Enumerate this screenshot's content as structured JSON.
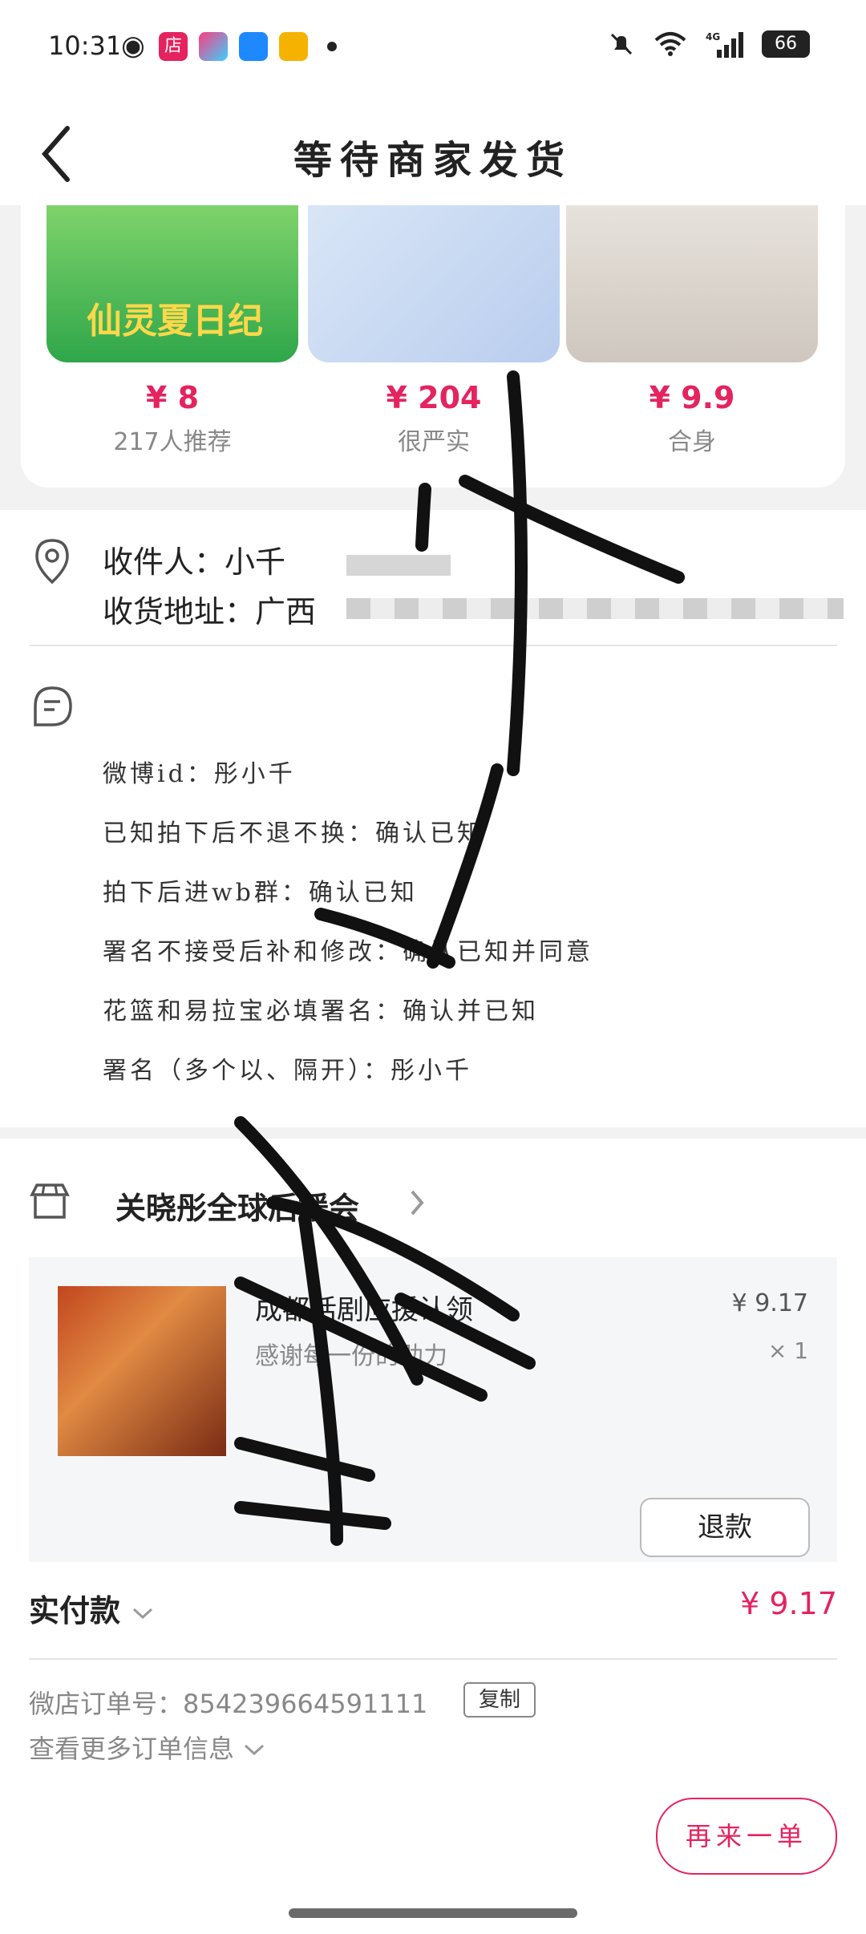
{
  "status": {
    "time": "10:31",
    "battery": "66",
    "notif_labels": [
      "店"
    ]
  },
  "header": {
    "title": "等待商家发货"
  },
  "recommend": [
    {
      "price": "¥ 8",
      "sub": "217人推荐",
      "img_text": "仙灵夏日纪"
    },
    {
      "price": "¥ 204",
      "sub": "很严实"
    },
    {
      "price": "¥ 9.9",
      "sub": "合身"
    }
  ],
  "address": {
    "recipient": "收件人：小千",
    "address": "收货地址：广西"
  },
  "notes": [
    "微博id：彤小千",
    "已知拍下后不退不换：确认已知",
    "拍下后进wb群：确认已知",
    "署名不接受后补和修改：确认已知并同意",
    "花篮和易拉宝必填署名：确认并已知",
    "署名（多个以、隔开）：彤小千"
  ],
  "shop": {
    "name": "关晓彤全球后援会",
    "product_title": "成都话剧应援认领",
    "product_sub": "感谢每一份的助力",
    "product_price": "¥ 9.17",
    "product_qty": "× 1",
    "refund_label": "退款"
  },
  "payment": {
    "label": "实付款",
    "amount": "¥ 9.17",
    "order_no": "微店订单号：854239664591111",
    "copy_label": "复制",
    "more_label": "查看更多订单信息"
  },
  "footer": {
    "again_label": "再来一单"
  },
  "colors": {
    "accent": "#e4235f",
    "page_bg": "#f2f2f2"
  }
}
